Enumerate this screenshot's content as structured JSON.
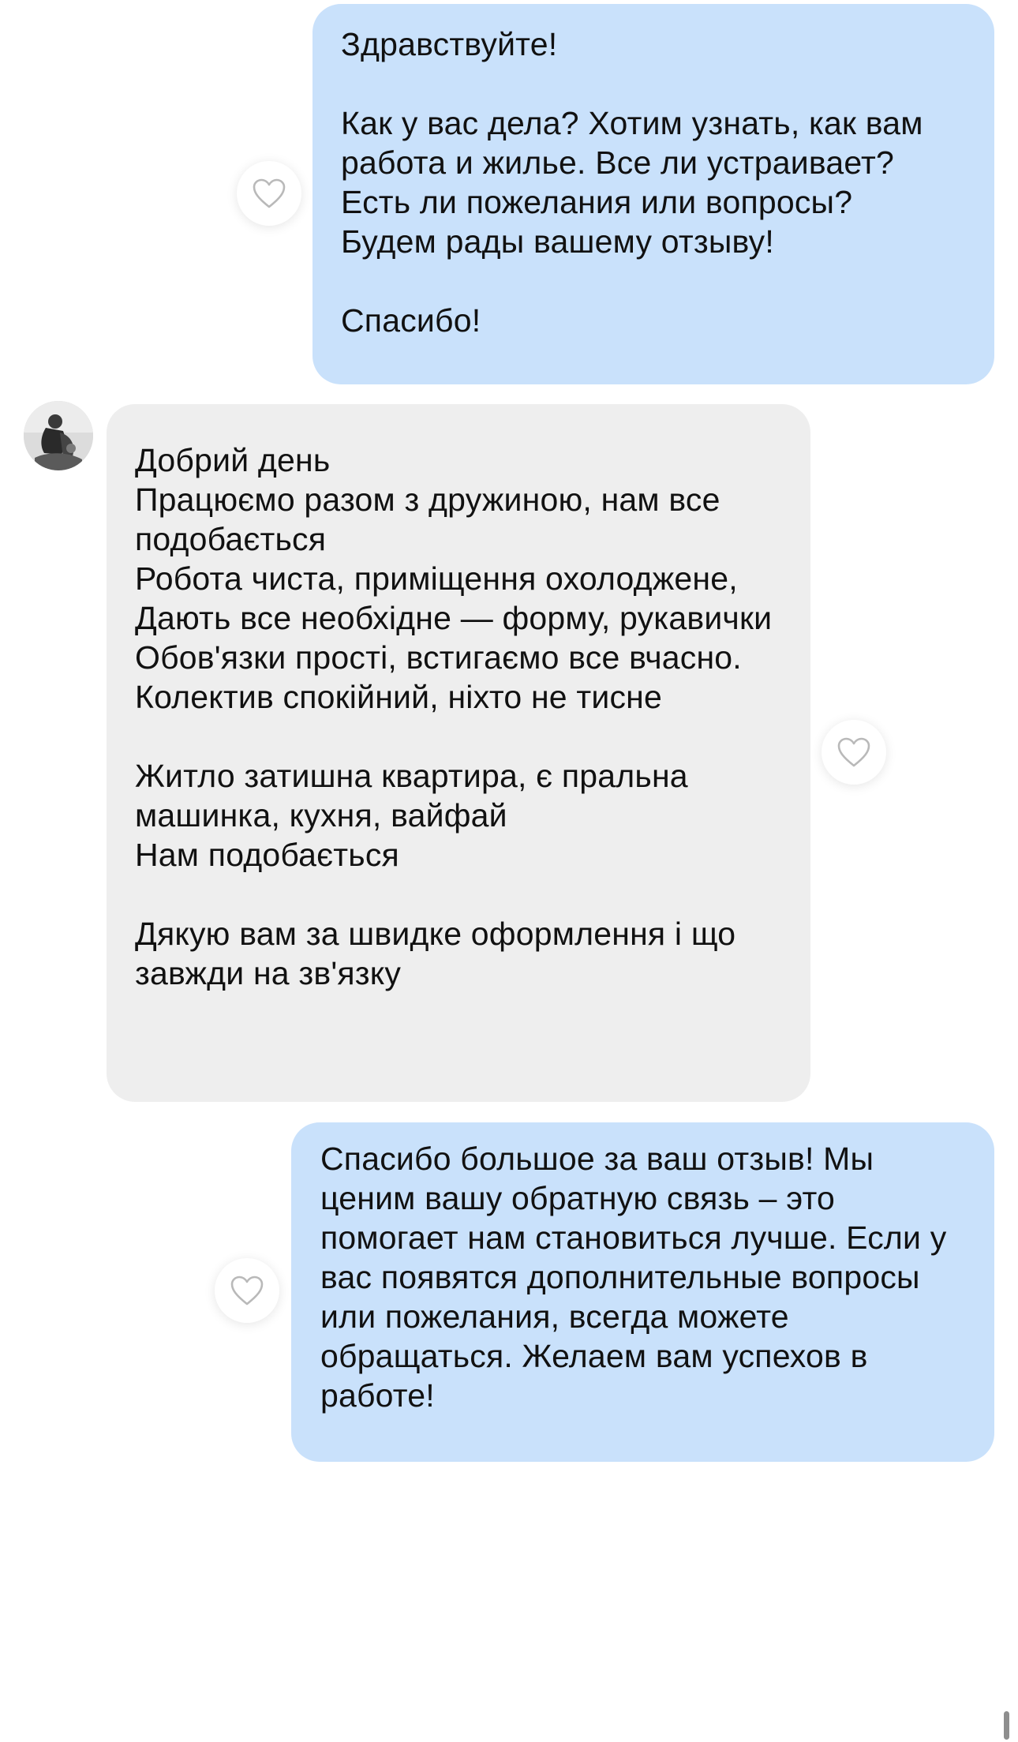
{
  "chat": {
    "messages": [
      {
        "direction": "outgoing",
        "text": "Здравствуйте!\n\nКак у вас дела? Хотим узнать, как вам работа и жилье. Все ли устраивает?\nЕсть ли пожелания или вопросы?\nБудем рады вашему отзыву!\n\nСпасибо!"
      },
      {
        "direction": "incoming",
        "text": "Добрий день\nПрацюємо  разом з дружиною, нам все подобається\nРобота чиста, приміщення охолоджене,\nДають все необхідне — форму, рукавички\nОбов'язки прості, встигаємо все вчасно.\nКолектив спокійний, ніхто не тисне\n\nЖитло  затишна квартира, є пральна машинка, кухня, вайфай\nНам подобається\n\nДякую вам за швидке оформлення і що завжди на зв'язку"
      },
      {
        "direction": "outgoing",
        "text": "Спасибо большое за ваш отзыв! Мы ценим вашу обратную связь – это помогает нам становиться лучше. Если у вас появятся дополнительные вопросы или пожелания, всегда можете обращаться. Желаем вам успехов в работе!"
      }
    ]
  },
  "icons": {
    "like": "heart-outline-icon",
    "avatar": "user-avatar-photo"
  },
  "colors": {
    "outgoing_bubble": "#c9e1fb",
    "incoming_bubble": "#eeeeee",
    "text": "#111111",
    "background": "#ffffff"
  }
}
